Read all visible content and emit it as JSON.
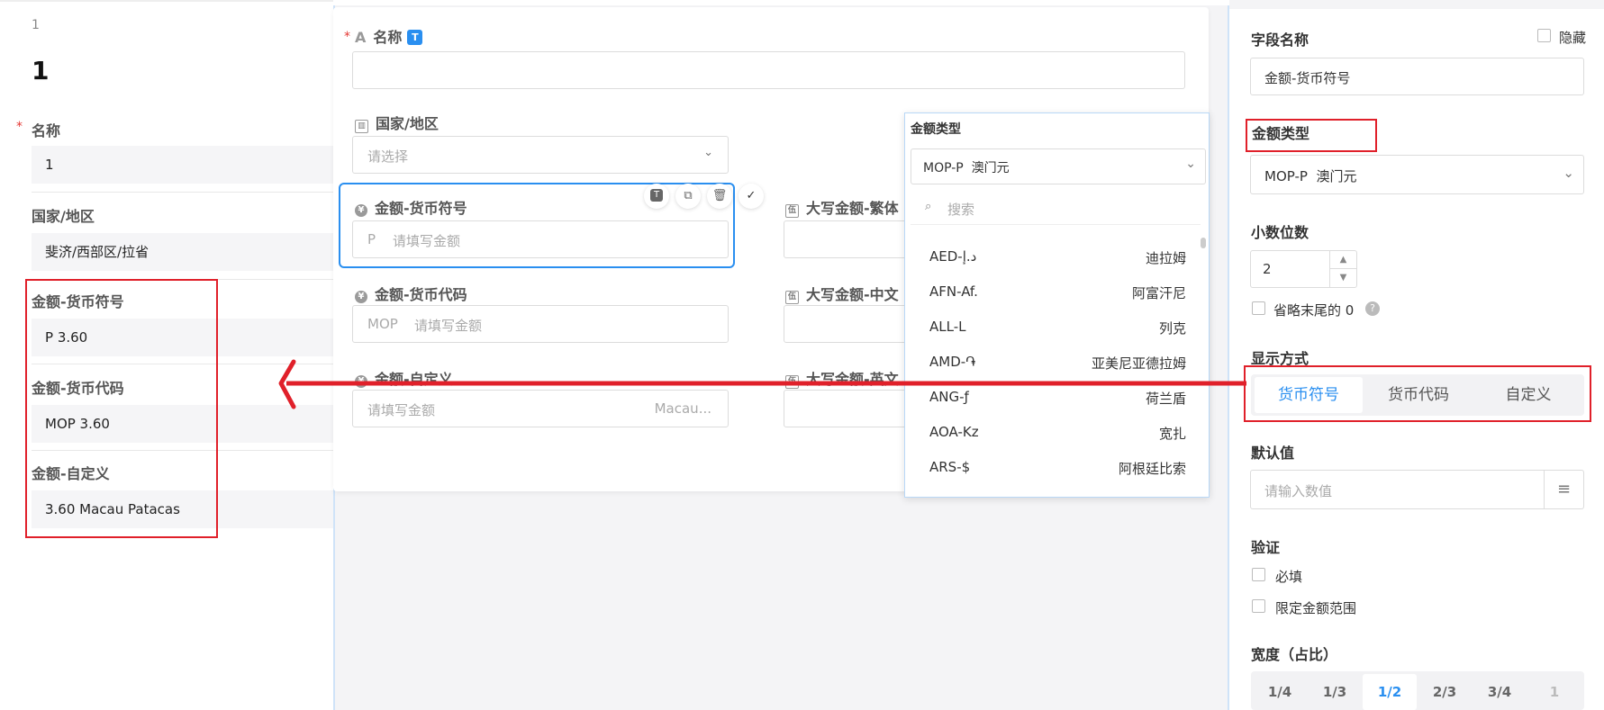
{
  "left_preview": {
    "record_no": "1",
    "record_title": "1",
    "name_label": "名称",
    "name_required": "*",
    "name_value": "1",
    "country_label": "国家/地区",
    "country_value": "斐济/西部区/拉省",
    "amount_symbol_label": "金额-货币符号",
    "amount_symbol_value": "P 3.60",
    "amount_code_label": "金额-货币代码",
    "amount_code_value": "MOP 3.60",
    "amount_custom_label": "金额-自定义",
    "amount_custom_value": "3.60 Macau Patacas"
  },
  "form": {
    "name_required": "*",
    "name_label": "名称",
    "name_badge": "T",
    "country_label": "国家/地区",
    "country_placeholder": "请选择",
    "symbol_label": "金额-货币符号",
    "symbol_prefix": "P",
    "symbol_placeholder": "请填写金额",
    "code_label": "金额-货币代码",
    "code_prefix": "MOP",
    "code_placeholder": "请填写金额",
    "custom_label": "金额-自定义",
    "custom_placeholder": "请填写金额",
    "custom_suffix": "Macau...",
    "trad_label": "大写金额-繁体",
    "chinese_label": "大写金额-中文",
    "english_label": "大写金额-英文",
    "toolbar": {
      "type_badge": "T",
      "copy": "⧉",
      "delete": "🗑",
      "confirm": "✓"
    }
  },
  "currency_dropdown": {
    "title": "金额类型",
    "selected": "MOP-P  澳门元",
    "search_placeholder": "搜索",
    "items": [
      {
        "code": "AED-د.إ",
        "name": "迪拉姆"
      },
      {
        "code": "AFN-Af.",
        "name": "阿富汗尼"
      },
      {
        "code": "ALL-L",
        "name": "列克"
      },
      {
        "code": "AMD-֏",
        "name": "亚美尼亚德拉姆"
      },
      {
        "code": "ANG-ƒ",
        "name": "荷兰盾"
      },
      {
        "code": "AOA-Kz",
        "name": "宽扎"
      },
      {
        "code": "ARS-$",
        "name": "阿根廷比索"
      }
    ]
  },
  "settings": {
    "field_name_label": "字段名称",
    "hide_label": "隐藏",
    "field_name_value": "金额-货币符号",
    "amount_type_label": "金额类型",
    "amount_type_value": "MOP-P  澳门元",
    "decimals_label": "小数位数",
    "decimals_value": "2",
    "omit_zero_label": "省略末尾的 0",
    "display_label": "显示方式",
    "display_options": [
      "货币符号",
      "货币代码",
      "自定义"
    ],
    "display_selected": "货币符号",
    "default_label": "默认值",
    "default_placeholder": "请输入数值",
    "validation_label": "验证",
    "required_label": "必填",
    "range_label": "限定金额范围",
    "width_label": "宽度（占比）",
    "width_options": [
      "1/4",
      "1/3",
      "1/2",
      "2/3",
      "3/4",
      "1"
    ],
    "width_selected": "1/2"
  },
  "colors": {
    "accent": "#2a8ff0",
    "highlight": "#e0202a"
  }
}
